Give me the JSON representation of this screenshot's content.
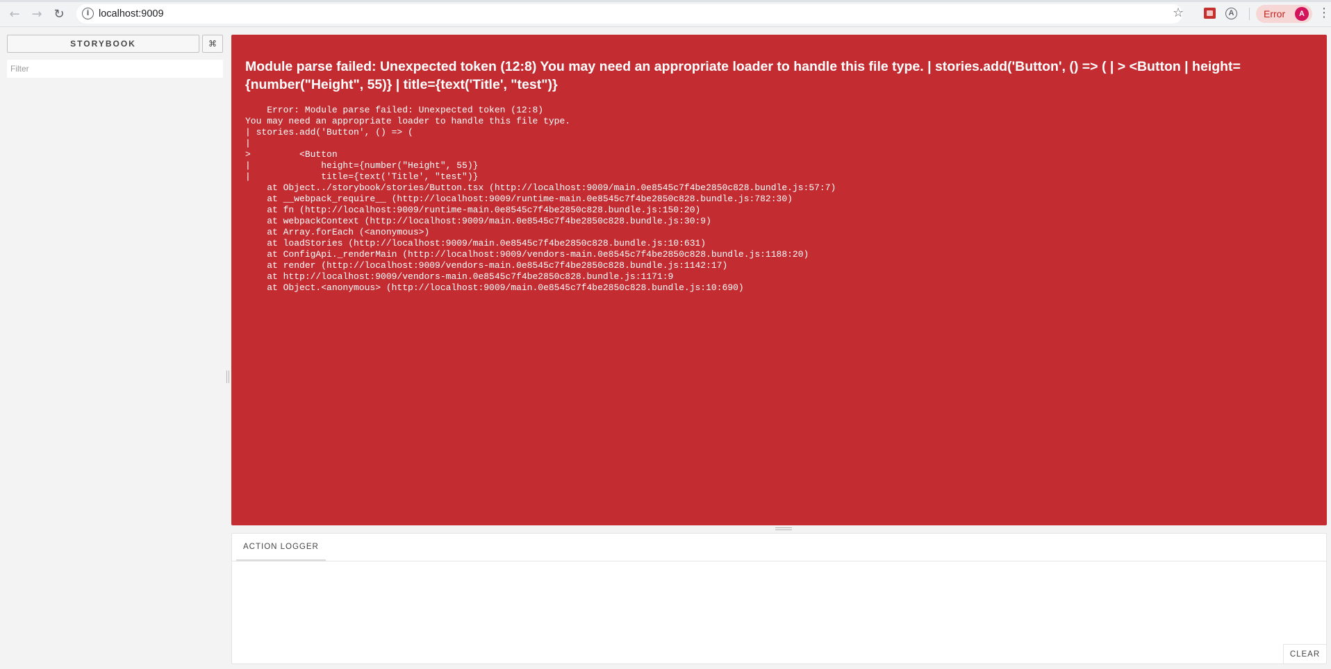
{
  "browser": {
    "url": "localhost:9009",
    "info_icon": "i",
    "back_icon": "←",
    "forward_icon": "→",
    "reload_icon": "↻",
    "star_icon": "☆",
    "ext_icon": "A",
    "error_label": "Error",
    "avatar_letter": "A",
    "menu_icon": "⋮"
  },
  "sidebar": {
    "brand_label": "STORYBOOK",
    "shortcut_icon": "⌘",
    "filter_placeholder": "Filter"
  },
  "error": {
    "title": "Module parse failed: Unexpected token (12:8) You may need an appropriate loader to handle this file type. | stories.add('Button', () => ( | > <Button | height={number(\"Height\", 55)} | title={text('Title', \"test\")}",
    "stack": [
      "    Error: Module parse failed: Unexpected token (12:8)",
      "You may need an appropriate loader to handle this file type.",
      "| stories.add('Button', () => (",
      "|",
      ">         <Button",
      "|             height={number(\"Height\", 55)}",
      "|             title={text('Title', \"test\")}",
      "    at Object../storybook/stories/Button.tsx (http://localhost:9009/main.0e8545c7f4be2850c828.bundle.js:57:7)",
      "    at __webpack_require__ (http://localhost:9009/runtime-main.0e8545c7f4be2850c828.bundle.js:782:30)",
      "    at fn (http://localhost:9009/runtime-main.0e8545c7f4be2850c828.bundle.js:150:20)",
      "    at webpackContext (http://localhost:9009/main.0e8545c7f4be2850c828.bundle.js:30:9)",
      "    at Array.forEach (<anonymous>)",
      "    at loadStories (http://localhost:9009/main.0e8545c7f4be2850c828.bundle.js:10:631)",
      "    at ConfigApi._renderMain (http://localhost:9009/vendors-main.0e8545c7f4be2850c828.bundle.js:1188:20)",
      "    at render (http://localhost:9009/vendors-main.0e8545c7f4be2850c828.bundle.js:1142:17)",
      "    at http://localhost:9009/vendors-main.0e8545c7f4be2850c828.bundle.js:1171:9",
      "    at Object.<anonymous> (http://localhost:9009/main.0e8545c7f4be2850c828.bundle.js:10:690)"
    ]
  },
  "addon": {
    "tab_label": "ACTION LOGGER",
    "clear_label": "CLEAR"
  }
}
